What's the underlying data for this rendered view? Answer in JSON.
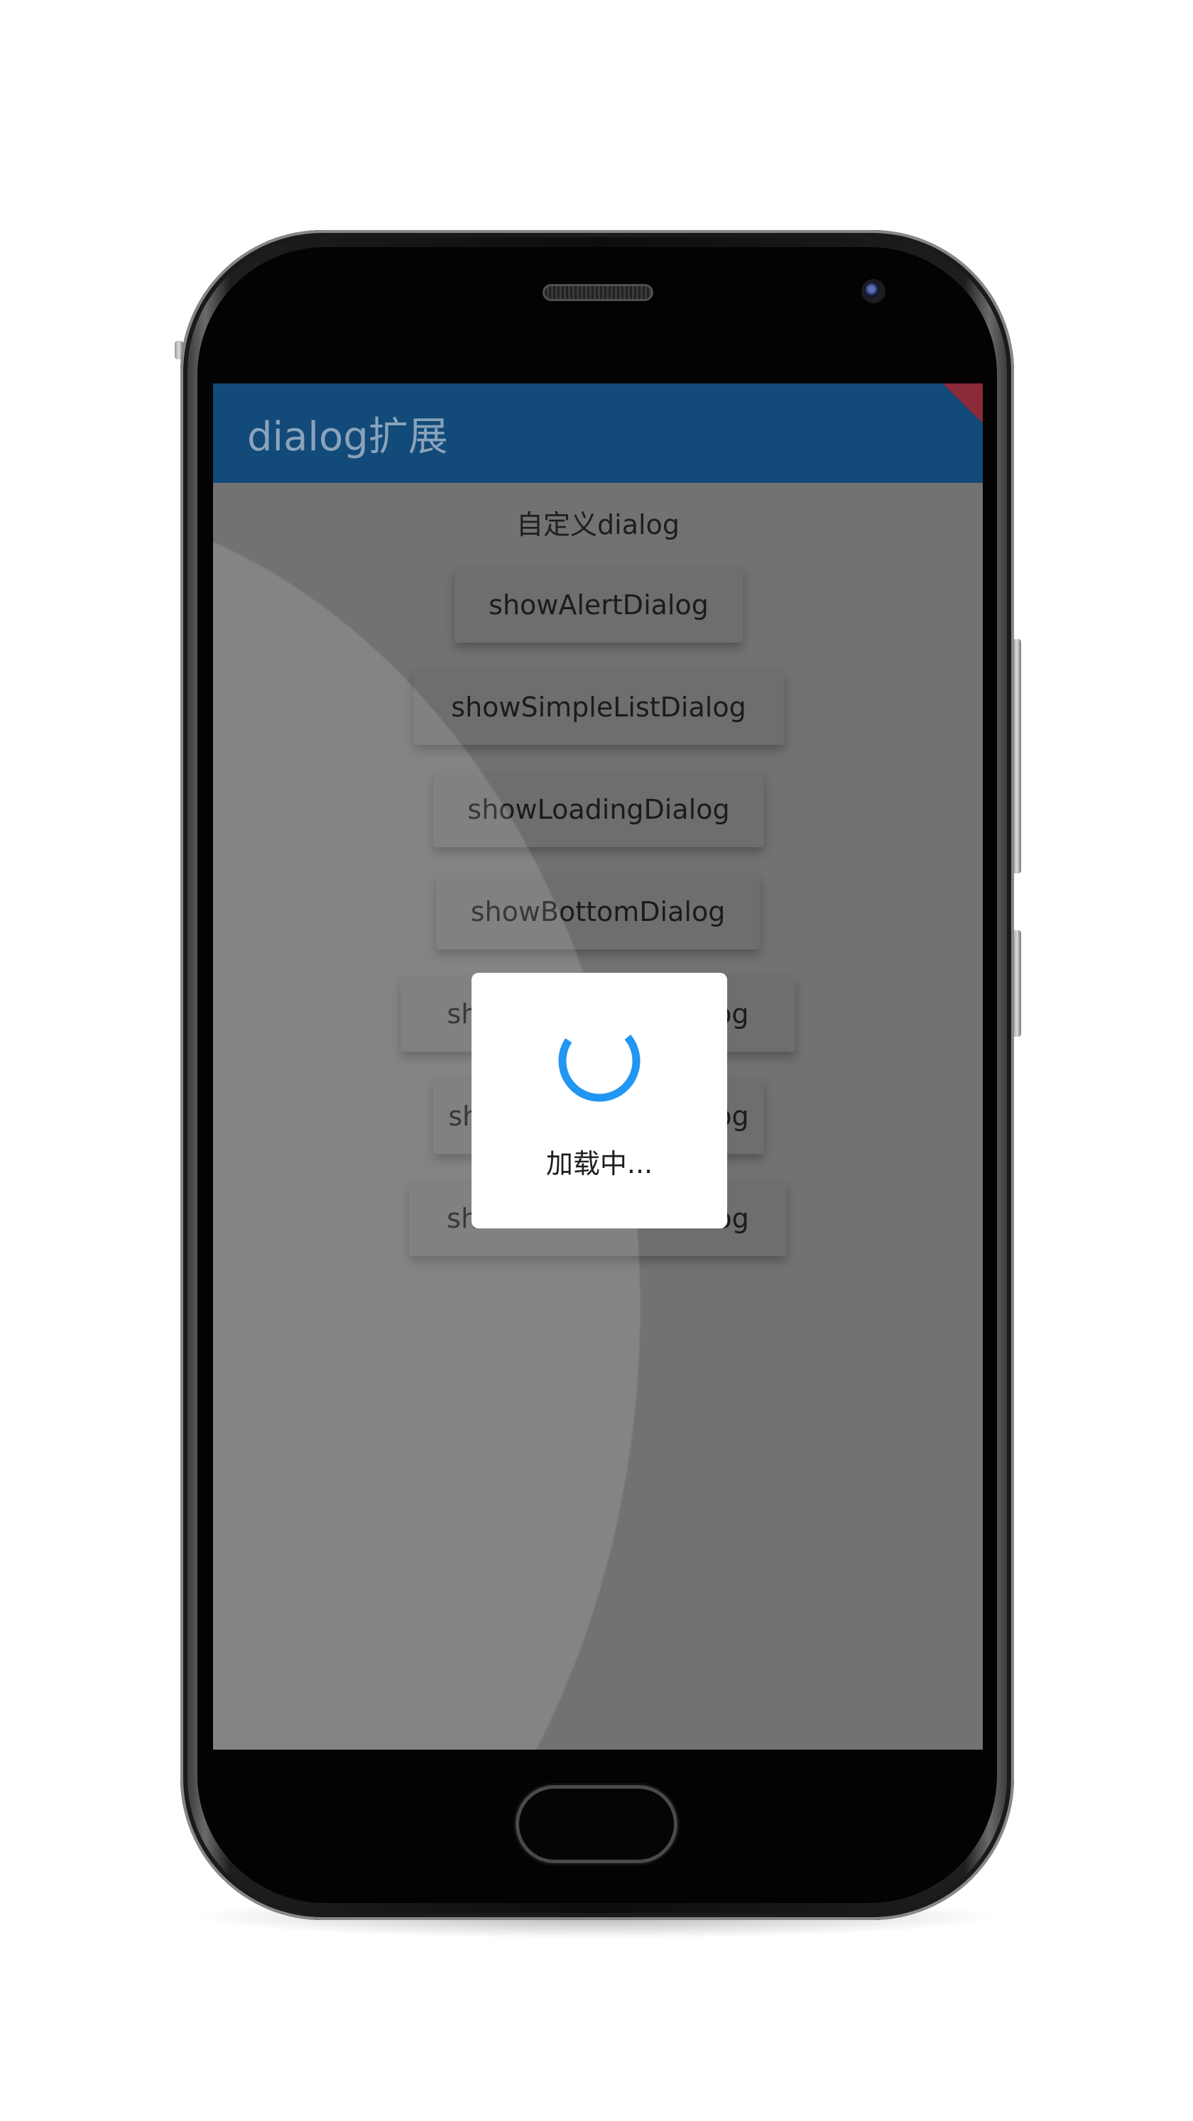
{
  "app_bar": {
    "title": "dialog扩展",
    "color": "#124a79"
  },
  "main": {
    "subtitle": "自定义dialog",
    "buttons": [
      {
        "label": "showAlertDialog"
      },
      {
        "label": "showSimpleListDialog"
      },
      {
        "label": "showLoadingDialog"
      },
      {
        "label": "showBottomDialog"
      },
      {
        "label": "showBottomListDialog"
      },
      {
        "label": "showDatePickerDialog"
      },
      {
        "label": "showTimePickerDialog"
      }
    ]
  },
  "loading_dialog": {
    "message": "加载中...",
    "spinner_color": "#2196f3",
    "spinner_icon": "loading-spinner-icon"
  }
}
